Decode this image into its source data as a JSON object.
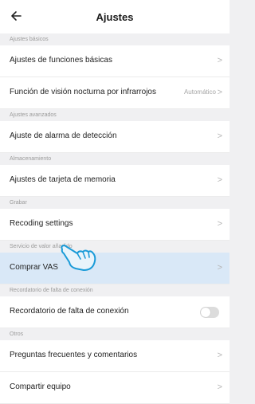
{
  "header": {
    "title": "Ajustes",
    "back_icon": "arrow-left-icon"
  },
  "sections": [
    {
      "header": "Ajustes básicos",
      "rows": [
        {
          "label": "Ajustes de funciones básicas"
        },
        {
          "label": "Función de visión nocturna por infrarrojos",
          "value": "Automático"
        }
      ]
    },
    {
      "header": "Ajustes avanzados",
      "rows": [
        {
          "label": "Ajuste de alarma de detección"
        }
      ]
    },
    {
      "header": "Almacenamiento",
      "rows": [
        {
          "label": "Ajustes de tarjeta de memoria"
        }
      ]
    },
    {
      "header": "Grabar",
      "rows": [
        {
          "label": "Recoding settings"
        }
      ]
    },
    {
      "header": "Servicio de valor añadido",
      "rows": [
        {
          "label": "Comprar VAS"
        }
      ]
    },
    {
      "header": "Recordatorio de falta de conexión",
      "rows": [
        {
          "label": "Recordatorio de falta de conexión",
          "toggle": false
        }
      ]
    },
    {
      "header": "Otros",
      "rows": [
        {
          "label": "Preguntas frecuentes y comentarios"
        },
        {
          "label": "Compartir equipo"
        }
      ]
    }
  ],
  "chevron": ">",
  "colors": {
    "highlight": "#d9e8f7",
    "hand": "#1a9bd8"
  }
}
